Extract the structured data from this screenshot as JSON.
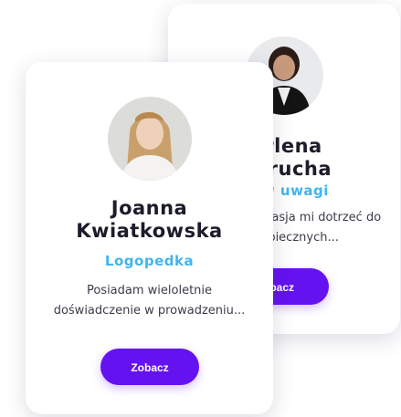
{
  "cards": [
    {
      "name_line1": "Joanna",
      "name_line2": "Kwiatkowska",
      "role": "Logopedka",
      "description": "Posiadam wieloletnie doświadczenie w prowadzeniu...",
      "button_label": "Zobacz"
    },
    {
      "name_line1": "rlena",
      "name_line2": "erucha",
      "role": "ytów uwagi",
      "description": "owanie i pasja mi dotrzeć do dopiecznych...",
      "button_label": "obacz"
    }
  ],
  "colors": {
    "accent": "#6512f0",
    "role": "#40b6ec",
    "name": "#1c1c2b"
  }
}
